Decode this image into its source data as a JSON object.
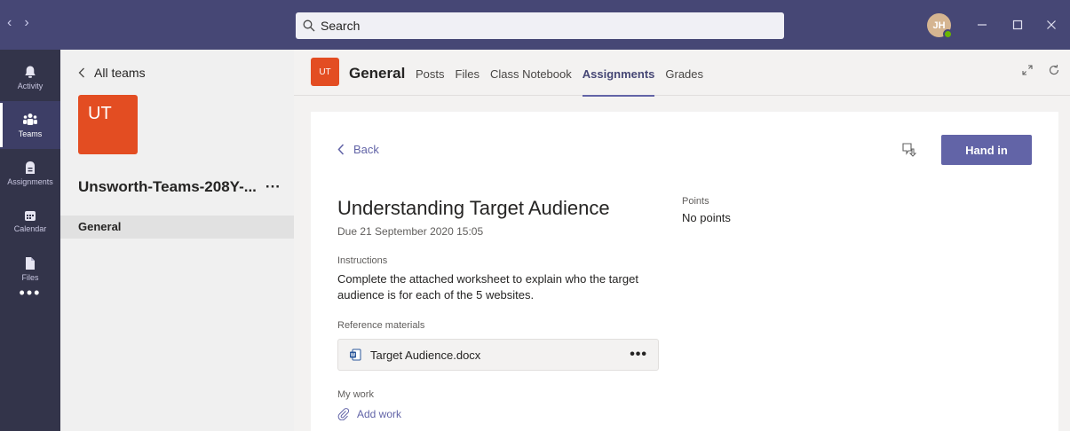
{
  "titlebar": {
    "search_placeholder": "Search",
    "avatar_initials": "JH"
  },
  "rail": {
    "items": [
      {
        "label": "Activity",
        "icon": "bell-icon"
      },
      {
        "label": "Teams",
        "icon": "teams-icon"
      },
      {
        "label": "Assignments",
        "icon": "assignments-icon"
      },
      {
        "label": "Calendar",
        "icon": "calendar-icon"
      },
      {
        "label": "Files",
        "icon": "file-icon"
      }
    ],
    "more": "•••"
  },
  "panel": {
    "all_teams": "All teams",
    "team_initials": "UT",
    "team_name": "Unsworth-Teams-208Y-...",
    "team_more": "···",
    "channel": "General"
  },
  "header": {
    "tile": "UT",
    "title": "General",
    "tabs": [
      "Posts",
      "Files",
      "Class Notebook",
      "Assignments",
      "Grades"
    ],
    "active_tab": "Assignments"
  },
  "assignment": {
    "back": "Back",
    "hand_in": "Hand in",
    "title": "Understanding Target Audience",
    "due": "Due 21 September 2020 15:05",
    "points_label": "Points",
    "points_value": "No points",
    "instructions_label": "Instructions",
    "instructions": "Complete the attached worksheet to explain who the target audience is for each of the 5 websites.",
    "reference_label": "Reference materials",
    "file_name": "Target Audience.docx",
    "file_more": "•••",
    "my_work_label": "My work",
    "add_work": "Add work"
  },
  "colors": {
    "titlebar": "#464775",
    "rail": "#33344a",
    "accent": "#6264a7",
    "team_tile": "#e34d22"
  }
}
